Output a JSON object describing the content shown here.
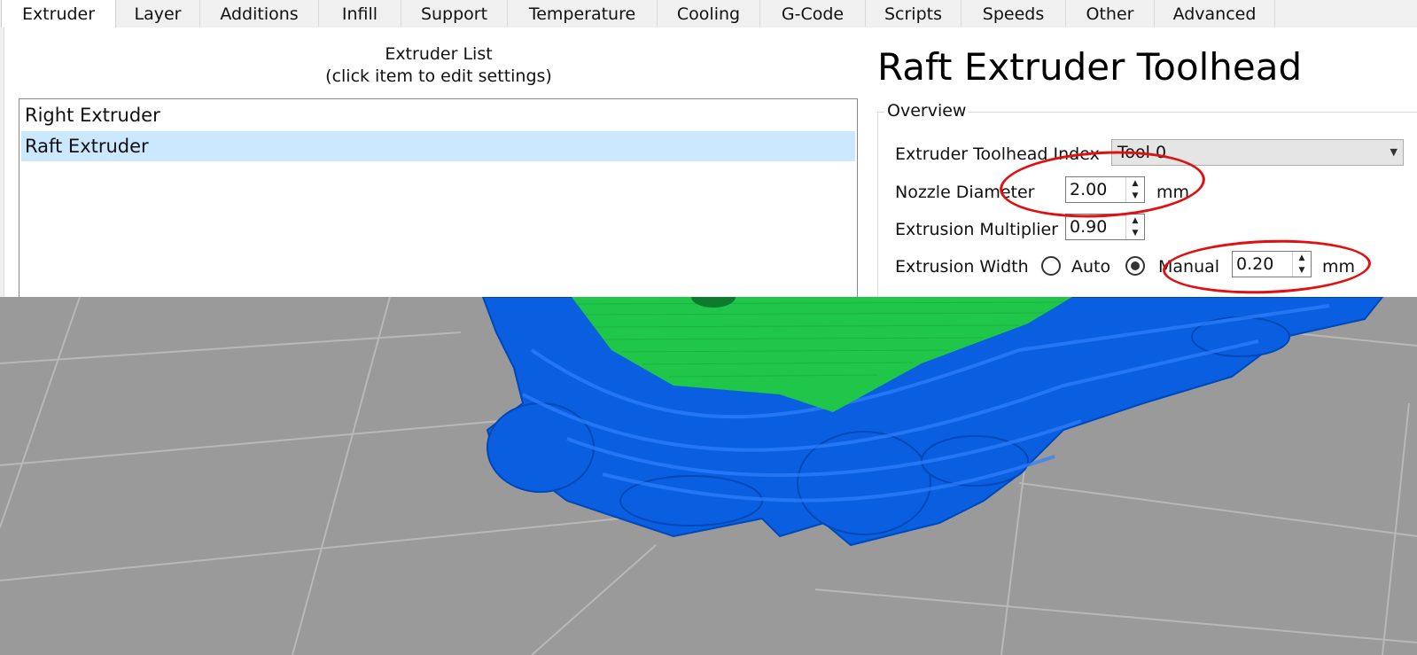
{
  "tabs": [
    {
      "label": "Extruder",
      "active": true
    },
    {
      "label": "Layer"
    },
    {
      "label": "Additions"
    },
    {
      "label": "Infill"
    },
    {
      "label": "Support"
    },
    {
      "label": "Temperature"
    },
    {
      "label": "Cooling"
    },
    {
      "label": "G-Code"
    },
    {
      "label": "Scripts"
    },
    {
      "label": "Speeds"
    },
    {
      "label": "Other"
    },
    {
      "label": "Advanced"
    }
  ],
  "extruder_list": {
    "title_line1": "Extruder List",
    "title_line2": "(click item to edit settings)",
    "items": [
      {
        "label": "Right Extruder",
        "selected": false
      },
      {
        "label": "Raft Extruder",
        "selected": true
      }
    ]
  },
  "editor": {
    "title": "Raft Extruder Toolhead",
    "group_label": "Overview",
    "toolhead_index_label": "Extruder Toolhead Index",
    "toolhead_index_value": "Tool 0",
    "nozzle_label": "Nozzle Diameter",
    "nozzle_value": "2.00",
    "nozzle_unit": "mm",
    "multiplier_label": "Extrusion Multiplier",
    "multiplier_value": "0.90",
    "width_label": "Extrusion Width",
    "width_auto_label": "Auto",
    "width_manual_label": "Manual",
    "width_mode": "Manual",
    "width_value": "0.20",
    "width_unit": "mm"
  },
  "colors": {
    "selection": "#cce8ff",
    "annotation": "#e01010",
    "bed": "#9a9a9a",
    "raft": "#0a5fe0",
    "part": "#1fc64a"
  }
}
